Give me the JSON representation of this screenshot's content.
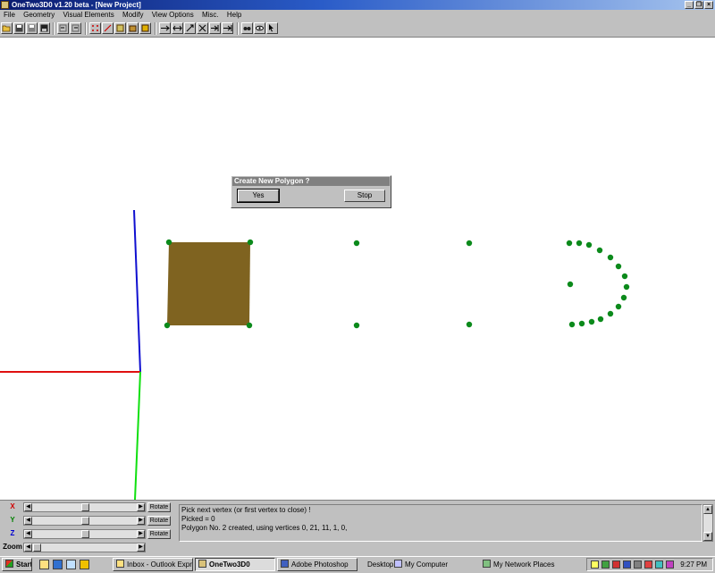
{
  "window": {
    "title": "OneTwo3D0  v1.20 beta - [New Project]"
  },
  "window_buttons": {
    "minimize": "_",
    "restore": "❐",
    "close": "×"
  },
  "menu": [
    "File",
    "Geometry",
    "Visual Elements",
    "Modify",
    "View Options",
    "Misc.",
    "Help"
  ],
  "toolbar_icons": [
    "open-folder-icon",
    "save-icon",
    "save-as-icon",
    "disk-icon",
    "undo-icon",
    "redo-icon",
    "point-tool-icon",
    "line-tool-icon",
    "polygon-tool-icon",
    "box-tool-icon",
    "texture-tool-icon",
    "move-icon",
    "move-horizontal-icon",
    "move-diagonal-icon",
    "scale-icon",
    "move-vertical-icon",
    "arrow-right-icon",
    "binoculars-icon",
    "eye-icon",
    "cursor-icon"
  ],
  "dialog": {
    "title": "Create New Polygon ?",
    "yes_label": "Yes",
    "stop_label": "Stop"
  },
  "scene": {
    "axis_colors": {
      "x": "#e01010",
      "y": "#10e010",
      "z": "#1010d0"
    },
    "polygon_fill": "#7f6320",
    "vertex_color": "#0b8a1b"
  },
  "controls": {
    "x": {
      "label": "X",
      "color": "#d00000",
      "button": "Rotate"
    },
    "y": {
      "label": "Y",
      "color": "#008000",
      "button": "Rotate"
    },
    "z": {
      "label": "Z",
      "color": "#0000d0",
      "button": "Rotate"
    },
    "zoom": {
      "label": "Zoom"
    }
  },
  "log": {
    "lines": [
      "Pick next vertex (or first vertex to close) !",
      "Picked = 0",
      "Polygon No. 2 created, using vertices 0, 21, 11, 1, 0,"
    ]
  },
  "taskbar": {
    "start": "Start",
    "buttons": [
      "Inbox - Outlook Express",
      "OneTwo3D0",
      "Adobe Photoshop"
    ],
    "desktop": "Desktop",
    "my_computer": "My Computer",
    "network": "My Network Places",
    "clock": "9:27 PM"
  }
}
